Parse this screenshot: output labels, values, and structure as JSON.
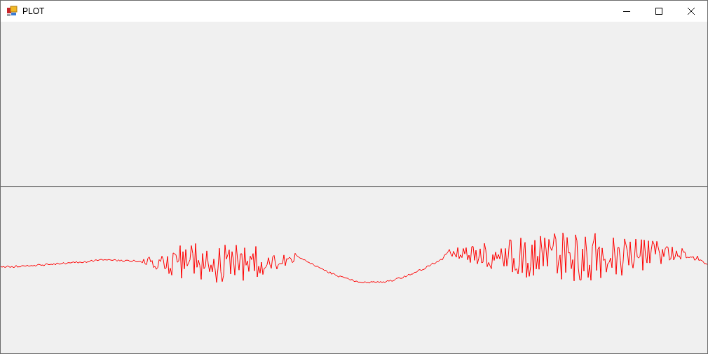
{
  "window": {
    "title": "PLOT"
  }
}
